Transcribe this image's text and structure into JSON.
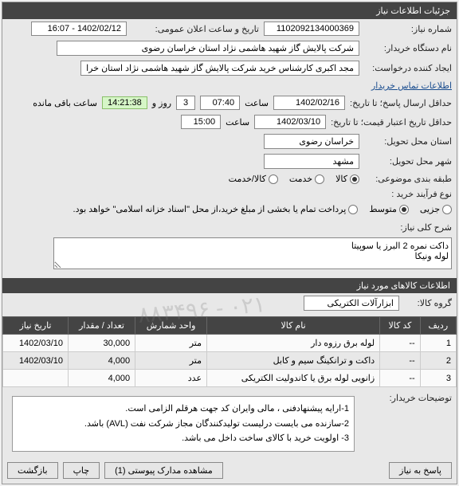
{
  "panel_title": "جزئیات اطلاعات نیاز",
  "labels": {
    "need_no": "شماره نیاز:",
    "pub_datetime": "تاریخ و ساعت اعلان عمومی:",
    "buyer_name": "نام دستگاه خریدار:",
    "requester": "ایجاد کننده درخواست:",
    "send_deadline": "حداقل ارسال پاسخ؛ تا تاریخ:",
    "saat": "ساعت",
    "rooz_va": "روز و",
    "remaining": "ساعت باقی مانده",
    "price_validity": "حداقل تاریخ اعتبار قیمت؛ تا تاریخ:",
    "state_loc": "استان محل تحویل:",
    "city_loc": "شهر محل تحویل:",
    "category": "طبقه بندی موضوعی:",
    "purchase_type": "نوع فرآیند خرید :",
    "desc_title": "شرح کلی نیاز:",
    "items_title": "اطلاعات کالاهای مورد نیاز",
    "group": "گروه کالا:",
    "buyer_notes": "توضیحات خریدار:",
    "contact_link": "اطلاعات تماس خریدار"
  },
  "values": {
    "need_no": "1102092134000369",
    "pub_datetime": "1402/02/12 - 16:07",
    "buyer_name": "شرکت پالایش گاز شهید هاشمی نژاد   استان خراسان رضوی",
    "requester": "مجد اکبری کارشناس خرید شرکت پالایش گاز شهید هاشمی نژاد   استان خرا",
    "deadline_date": "1402/02/16",
    "deadline_time": "07:40",
    "days_remain": "3",
    "time_remain": "14:21:38",
    "price_date": "1402/03/10",
    "price_time": "15:00",
    "state": "خراسان رضوی",
    "city": "مشهد",
    "group": "ابزارآلات الکتریکی",
    "description": "داکت نمره 2 البرز یا سوپیتا\nلوله ونیکا"
  },
  "category_options": [
    "کالا",
    "خدمت",
    "کالا/خدمت"
  ],
  "purchase_options": [
    "جزیی",
    "متوسط",
    "پرداخت تمام یا بخشی از مبلغ خرید،از محل \"اسناد خزانه اسلامی\" خواهد بود."
  ],
  "table": {
    "headers": [
      "ردیف",
      "کد کالا",
      "نام کالا",
      "واحد شمارش",
      "تعداد / مقدار",
      "تاریخ نیاز"
    ],
    "rows": [
      [
        "1",
        "--",
        "لوله برق رزوه دار",
        "متر",
        "30,000",
        "1402/03/10"
      ],
      [
        "2",
        "--",
        "داکت و ترانکینگ سیم و کابل",
        "متر",
        "4,000",
        "1402/03/10"
      ],
      [
        "3",
        "--",
        "زانویی لوله برق یا کاندولیت الکتریکی",
        "عدد",
        "4,000",
        ""
      ]
    ]
  },
  "notes": [
    "1-ارایه پیشنهادفنی ، مالی وایران کد جهت هرقلم الزامی است.",
    "2-سازنده می بایست درلیست تولیدکنندگان مجاز شرکت نفت (AVL)  باشد.",
    "3- اولویت خرید  با  کالای ساخت   داخل می باشد."
  ],
  "buttons": {
    "back": "بازگشت",
    "print": "چاپ",
    "attach": "مشاهده مدارک پیوستی (1)",
    "reply": "پاسخ به نیاز"
  },
  "watermark": "۰۲۱ - ۸۸۳۴۹۶"
}
